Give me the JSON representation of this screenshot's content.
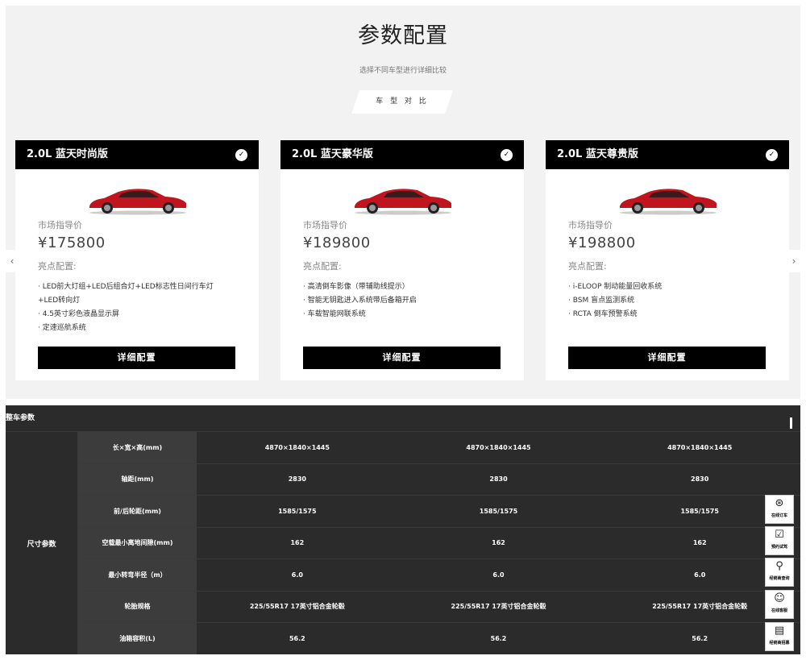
{
  "header": {
    "title": "参数配置",
    "subtitle": "选择不同车型进行详细比较",
    "compare_label": "车 型 对 比"
  },
  "cards": [
    {
      "name": "2.0L 蓝天时尚版",
      "price_label": "市场指导价",
      "price": "¥175800",
      "highlight_label": "亮点配置:",
      "features": [
        "· LED前大灯组+LED后组合灯+LED标志性日间行车灯",
        "+LED转向灯",
        "· 4.5英寸彩色液晶显示屏",
        "· 定速巡航系统"
      ],
      "button": "详细配置"
    },
    {
      "name": "2.0L 蓝天豪华版",
      "price_label": "市场指导价",
      "price": "¥189800",
      "highlight_label": "亮点配置:",
      "features": [
        "· 高清倒车影像（带辅助线提示）",
        "· 智能无钥匙进入系统带后备箱开启",
        "· 车载智能网联系统"
      ],
      "button": "详细配置"
    },
    {
      "name": "2.0L 蓝天尊贵版",
      "price_label": "市场指导价",
      "price": "¥198800",
      "highlight_label": "亮点配置:",
      "features": [
        "· i-ELOOP 制动能量回收系统",
        "· BSM 盲点监测系统",
        "· RCTA 倒车预警系统"
      ],
      "button": "详细配置"
    }
  ],
  "nav": {
    "prev": "‹",
    "next": "›"
  },
  "params": {
    "section_title": "整车参数",
    "group": "尺寸参数",
    "rows": [
      {
        "key": "长×宽×高(mm)",
        "values": [
          "4870×1840×1445",
          "4870×1840×1445",
          "4870×1840×1445"
        ]
      },
      {
        "key": "轴距(mm)",
        "values": [
          "2830",
          "2830",
          "2830"
        ]
      },
      {
        "key": "前/后轮距(mm)",
        "values": [
          "1585/1575",
          "1585/1575",
          "1585/1575"
        ]
      },
      {
        "key": "空载最小离地间隙(mm)",
        "values": [
          "162",
          "162",
          "162"
        ]
      },
      {
        "key": "最小转弯半径（m）",
        "values": [
          "6.0",
          "6.0",
          "6.0"
        ]
      },
      {
        "key": "轮胎规格",
        "values": [
          "225/55R17 17英寸铝合金轮毂",
          "225/55R17 17英寸铝合金轮毂",
          "225/55R17 17英寸铝合金轮毂"
        ]
      },
      {
        "key": "油箱容积(L)",
        "values": [
          "56.2",
          "56.2",
          "56.2"
        ]
      }
    ]
  },
  "side_tools": [
    {
      "icon": "steering-wheel-icon",
      "glyph": "⊛",
      "label": "在线订车"
    },
    {
      "icon": "calendar-check-icon",
      "glyph": "☑",
      "label": "预约试驾"
    },
    {
      "icon": "search-icon",
      "glyph": "⚲",
      "label": "经销商查询"
    },
    {
      "icon": "chat-icon",
      "glyph": "☺",
      "label": "在线客服"
    },
    {
      "icon": "store-icon",
      "glyph": "▤",
      "label": "经销商招募"
    }
  ],
  "colors": {
    "accent": "#000000",
    "car": "#c0141e",
    "table_bg": "#2b2b2b",
    "key_bg": "#3c3c3c"
  }
}
